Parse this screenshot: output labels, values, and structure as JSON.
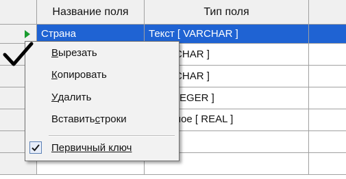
{
  "grid": {
    "headers": [
      "Название поля",
      "Тип поля"
    ],
    "selected_row": {
      "name": "Страна",
      "type": "Текст [ VARCHAR ]"
    },
    "rows": [
      {
        "type_visible": "[ VARCHAR ]"
      },
      {
        "type_visible": "[ VARCHAR ]"
      },
      {
        "type_visible": "e [ INTEGER ]"
      },
      {
        "type_visible": "ственное [ REAL ]"
      }
    ]
  },
  "menu": {
    "cut": {
      "accel": "В",
      "rest": "ырезать"
    },
    "copy": {
      "accel": "К",
      "rest": "опировать"
    },
    "delete": {
      "accel": "У",
      "rest": "далить"
    },
    "insert": {
      "pre": "Вставить ",
      "accel": "с",
      "rest": "троки"
    },
    "primary_key": {
      "accel": "П",
      "rest": "ервичный ключ"
    }
  },
  "colors": {
    "selection": "#1f63d3",
    "pointer": "#1a9c2f"
  }
}
